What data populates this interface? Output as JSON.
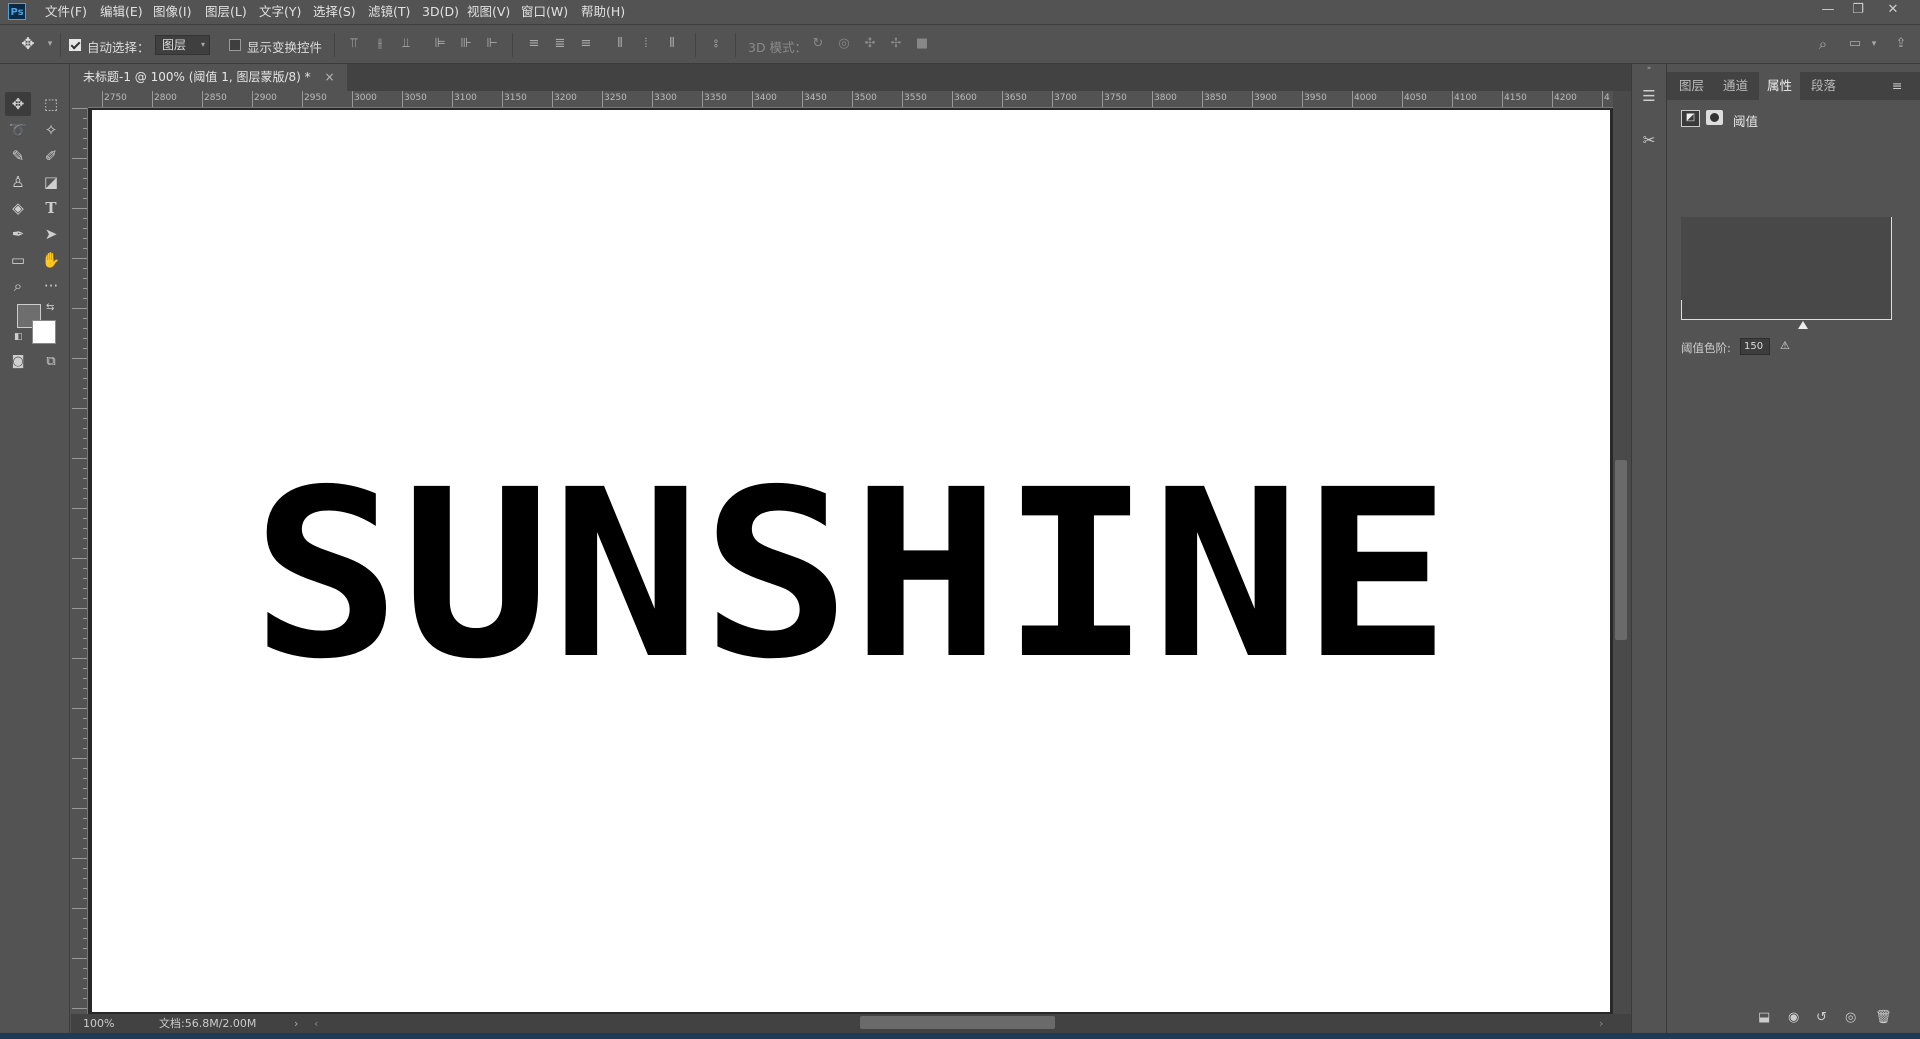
{
  "app": {
    "logo": "Ps"
  },
  "menu": [
    "文件(F)",
    "编辑(E)",
    "图像(I)",
    "图层(L)",
    "文字(Y)",
    "选择(S)",
    "滤镜(T)",
    "3D(D)",
    "视图(V)",
    "窗口(W)",
    "帮助(H)"
  ],
  "options": {
    "auto_select_label": "自动选择：",
    "auto_select_checked": true,
    "auto_select_target": "图层",
    "transform_controls_label": "显示变换控件",
    "transform_controls_checked": false,
    "mode_3d_label": "3D 模式："
  },
  "document": {
    "tab_title": "未标题-1 @ 100% (阈值 1, 图层蒙版/8) *",
    "close_glyph": "×",
    "canvas_text": "SUNSHINE"
  },
  "ruler": {
    "h_labels": [
      "2750",
      "2800",
      "2850",
      "2900",
      "2950",
      "3000",
      "3050",
      "3100",
      "3150",
      "3200",
      "3250",
      "3300",
      "3350",
      "3400",
      "3450",
      "3500",
      "3550",
      "3600",
      "3650",
      "3700",
      "3750",
      "3800",
      "3850",
      "3900",
      "3950",
      "4000",
      "4050",
      "4100",
      "4150",
      "4200",
      "4"
    ]
  },
  "status": {
    "zoom": "100%",
    "doc_info": "文档:56.8M/2.00M"
  },
  "properties": {
    "tabs": [
      "图层",
      "通道",
      "属性",
      "段落"
    ],
    "active_tab": "属性",
    "adjustment_name": "阈值",
    "threshold_label": "阈值色阶:",
    "threshold_value": "150"
  },
  "icons": {
    "move": "move-icon",
    "marquee": "marquee-icon",
    "lasso": "lasso-icon",
    "magic_wand": "magic-wand-icon",
    "eyedropper": "eyedropper-icon",
    "brush": "brush-icon",
    "stamp": "clone-stamp-icon",
    "eraser": "eraser-icon",
    "paint_bucket": "paint-bucket-icon",
    "type": "type-icon",
    "pen": "pen-icon",
    "path_select": "path-select-icon",
    "rectangle": "rectangle-icon",
    "hand": "hand-icon",
    "zoom": "zoom-icon",
    "more": "more-icon"
  },
  "colors": {
    "ui_bg": "#535353",
    "canvas": "#ffffff",
    "text_fill": "#000000",
    "accent": "#4aa3df"
  }
}
